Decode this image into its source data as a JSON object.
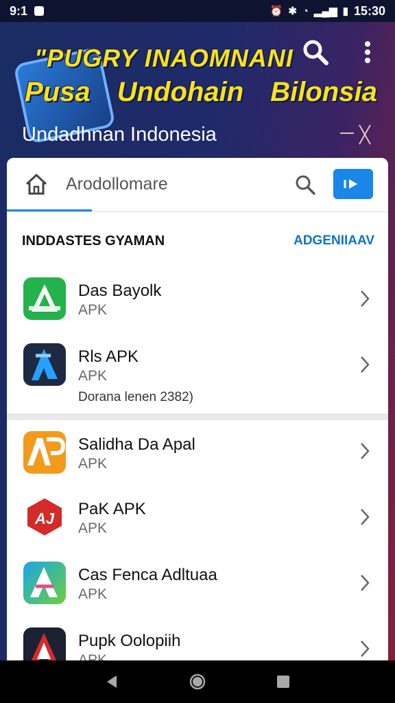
{
  "status_bar": {
    "time_left": "9:1",
    "time_right": "15:30"
  },
  "header": {
    "title_line1": "\"PUGRY INAOMNANI",
    "title_line2": "Pusa Undohain Bilonsia",
    "subtitle": "Undadhnan Indonesia"
  },
  "search": {
    "value": "Arodollomare"
  },
  "section": {
    "title": "INDDASTES GYAMAN",
    "action": "ADGENIIAAV"
  },
  "items": [
    {
      "name": "Das Bayolk",
      "type": "APK",
      "meta": "",
      "icon_letter": "A",
      "colors": [
        "#23b24b",
        "#1d8e3a"
      ]
    },
    {
      "name": "Rls APK",
      "type": "APK",
      "meta": "Dorana lenen 2382)",
      "icon_letter": "A",
      "colors": [
        "#1e2a44",
        "#27a0ff"
      ]
    },
    {
      "name": "Salidha Da Apal",
      "type": "APK",
      "meta": "",
      "icon_letter": "AP",
      "colors": [
        "#f39a1c",
        "#e46f0c"
      ]
    },
    {
      "name": "PaK APK",
      "type": "APK",
      "meta": "",
      "icon_letter": "AJ",
      "colors": [
        "#d42a2a",
        "#a61515"
      ]
    },
    {
      "name": "Cas Fenca Adltuaa",
      "type": "APK",
      "meta": "",
      "icon_letter": "A",
      "colors": [
        "#1aa6e8",
        "#6bcf3c"
      ]
    },
    {
      "name": "Pupk Oolopiih",
      "type": "APK",
      "meta": "",
      "icon_letter": "A",
      "colors": [
        "#1b2033",
        "#d62b2b"
      ]
    }
  ],
  "colors": {
    "accent": "#1a86e8",
    "title_yellow": "#ffe11a"
  }
}
